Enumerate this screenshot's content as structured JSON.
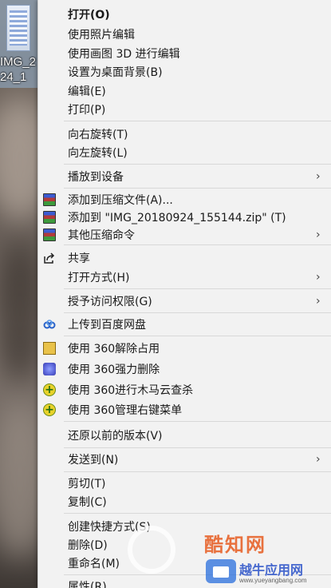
{
  "desktop": {
    "icon_caption": "IMG_2\n24_1"
  },
  "menu": {
    "items": [
      {
        "label": "打开(O)",
        "bold": true
      },
      {
        "label": "使用照片编辑"
      },
      {
        "label": "使用画图 3D 进行编辑"
      },
      {
        "label": "设置为桌面背景(B)"
      },
      {
        "label": "编辑(E)"
      },
      {
        "label": "打印(P)"
      },
      {
        "label": "向右旋转(T)"
      },
      {
        "label": "向左旋转(L)"
      },
      {
        "label": "播放到设备",
        "submenu": true
      },
      {
        "label": "添加到压缩文件(A)...",
        "icon": "winrar-icon"
      },
      {
        "label": "添加到 \"IMG_20180924_155144.zip\" (T)",
        "icon": "winrar-icon"
      },
      {
        "label": "其他压缩命令",
        "icon": "winrar-icon",
        "submenu": true
      },
      {
        "label": "共享",
        "icon": "share-icon"
      },
      {
        "label": "打开方式(H)",
        "submenu": true
      },
      {
        "label": "授予访问权限(G)",
        "submenu": true
      },
      {
        "label": "上传到百度网盘",
        "icon": "baidu-netdisk-icon"
      },
      {
        "label": "使用 360解除占用",
        "icon": "360-unlock-icon"
      },
      {
        "label": "使用 360强力删除",
        "icon": "360-force-delete-icon"
      },
      {
        "label": "使用 360进行木马云查杀",
        "icon": "360-scan-icon"
      },
      {
        "label": "使用 360管理右键菜单",
        "icon": "360-menu-manager-icon"
      },
      {
        "label": "还原以前的版本(V)"
      },
      {
        "label": "发送到(N)",
        "submenu": true
      },
      {
        "label": "剪切(T)"
      },
      {
        "label": "复制(C)"
      },
      {
        "label": "创建快捷方式(S)"
      },
      {
        "label": "删除(D)"
      },
      {
        "label": "重命名(M)"
      },
      {
        "label": "属性(R)"
      }
    ],
    "submenu_arrow": "›"
  },
  "watermarks": {
    "site_title": "酷知网",
    "site_title2": "越牛应用网",
    "site_url": "www.yueyangbang.com"
  },
  "colors": {
    "menu_bg": "#f2f2f2",
    "separator": "#d8d8d8",
    "text": "#1a1a1a"
  }
}
